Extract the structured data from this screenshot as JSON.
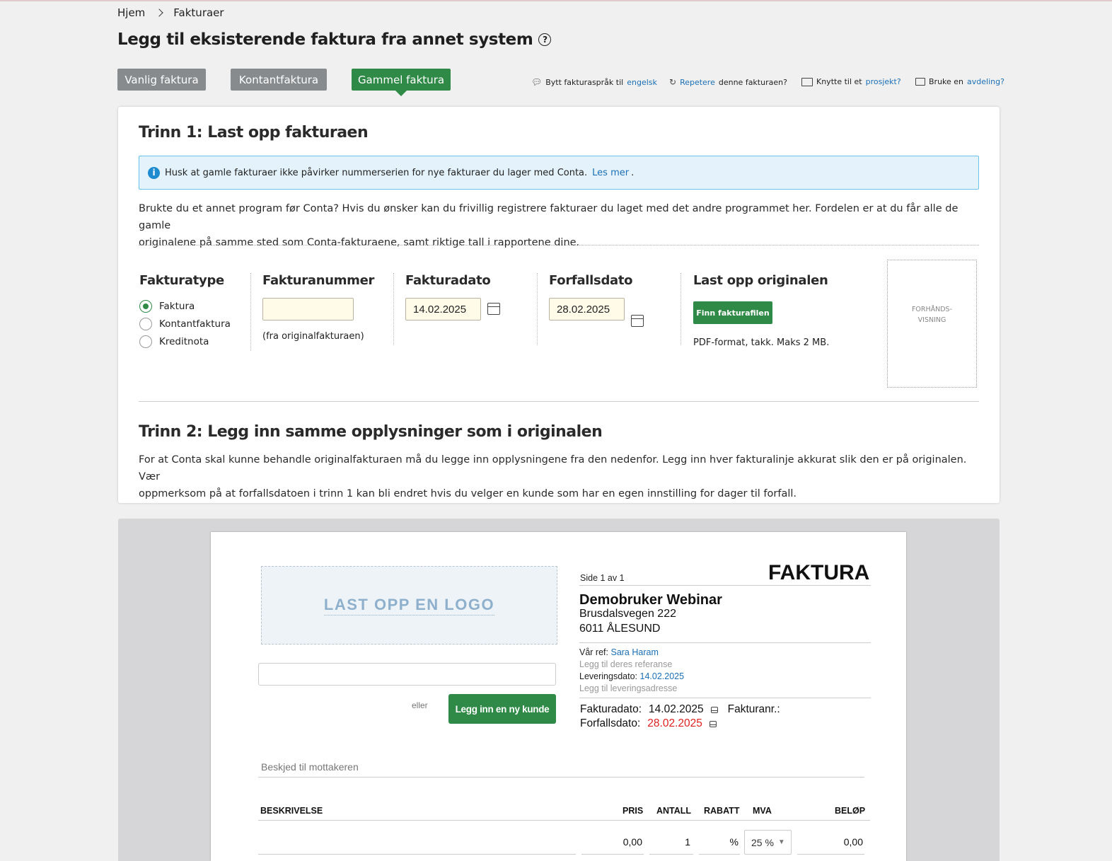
{
  "breadcrumb": {
    "home": "Hjem",
    "current": "Fakturaer"
  },
  "page_title": "Legg til eksisterende faktura fra annet system",
  "help_icon": "?",
  "tabs": [
    {
      "label": "Vanlig faktura",
      "active": false
    },
    {
      "label": "Kontantfaktura",
      "active": false
    },
    {
      "label": "Gammel faktura",
      "active": true
    }
  ],
  "options": {
    "language": {
      "text": "Bytt fakturaspråk til",
      "link": "engelsk",
      "icon": "chat-icon"
    },
    "repeat": {
      "link": "Repetere",
      "text": "denne fakturaen?",
      "icon": "repeat-icon"
    },
    "project": {
      "text": "Knytte til et",
      "link": "prosjekt?",
      "icon": "folder-icon"
    },
    "department": {
      "text": "Bruke en",
      "link": "avdeling?",
      "icon": "folder-open-icon"
    }
  },
  "step1": {
    "title": "Trinn 1:  Last opp fakturaen",
    "info_text": "Husk at gamle fakturaer ikke påvirker nummerserien for nye fakturaer du lager med Conta.",
    "info_link": "Les mer",
    "info_end": ".",
    "description_line1": "Brukte du et annet program før Conta? Hvis du ønsker kan du frivillig registrere fakturaer du laget med det andre programmet her. Fordelen er at du får alle de gamle",
    "description_line2": "originalene på samme sted som Conta-fakturaene, samt riktige tall i rapportene dine.",
    "invoice_type": {
      "label": "Fakturatype",
      "options": [
        "Faktura",
        "Kontantfaktura",
        "Kreditnota"
      ],
      "selected": "Faktura"
    },
    "invoice_number": {
      "label": "Fakturanummer",
      "value": "",
      "hint": "(fra originalfakturaen)"
    },
    "invoice_date": {
      "label": "Fakturadato",
      "value": "14.02.2025"
    },
    "due_date": {
      "label": "Forfallsdato",
      "value": "28.02.2025"
    },
    "upload": {
      "label": "Last opp originalen",
      "button": "Finn fakturafilen",
      "hint": "PDF-format, takk. Maks 2 MB."
    },
    "preview": {
      "line1": "FORHÅNDS-",
      "line2": "VISNING"
    }
  },
  "step2": {
    "title": "Trinn 2:  Legg inn samme opplysninger som i originalen",
    "description_line1": "For at Conta skal kunne behandle originalfakturaen må du legge inn opplysningene fra den nedenfor.  Legg inn hver fakturalinje akkurat slik den er på originalen.  Vær",
    "description_line2": "oppmerksom på at forfallsdatoen i trinn 1 kan bli endret hvis du velger en kunde som har en egen innstilling for dager til forfall."
  },
  "invoice": {
    "logo_placeholder": "LAST OPP EN LOGO",
    "customer_input_value": "",
    "or": "eller",
    "new_customer_button": "Legg inn en ny kunde",
    "page": "Side 1 av 1",
    "doc_title": "FAKTURA",
    "company_name": "Demobruker Webinar",
    "address1": "Brusdalsvegen 222",
    "address2": "6011 ÅLESUND",
    "our_ref_label": "Vår ref:",
    "our_ref_value": "Sara Haram",
    "their_ref_placeholder": "Legg til deres referanse",
    "delivery_date_label": "Leveringsdato:",
    "delivery_date_value": "14.02.2025",
    "delivery_address_placeholder": "Legg til leveringsadresse",
    "invoice_date_label": "Fakturadato:",
    "invoice_date_value": "14.02.2025",
    "invoice_no_label": "Fakturanr.:",
    "due_date_label": "Forfallsdato:",
    "due_date_value": "28.02.2025",
    "message_placeholder": "Beskjed til mottakeren",
    "table": {
      "headers": {
        "description": "BESKRIVELSE",
        "price": "PRIS",
        "qty": "ANTALL",
        "discount": "RABATT",
        "vat": "MVA",
        "amount": "BELØP"
      },
      "rows": [
        {
          "description": "",
          "price": "0,00",
          "qty": "1",
          "discount": "%",
          "vat": "25 %",
          "amount": "0,00"
        }
      ]
    },
    "colors": {
      "link": "#1b6fb5",
      "due_red": "#e02020",
      "green": "#2e8a46"
    }
  }
}
